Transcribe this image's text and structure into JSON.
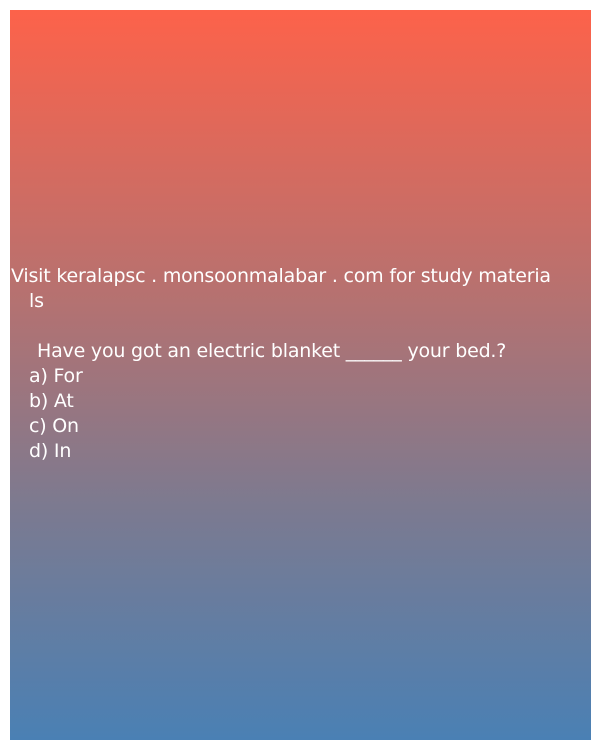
{
  "promo": {
    "line1": "Visit keralapsc . monsoonmalabar . com for study materia",
    "line2": "ls"
  },
  "question": {
    "text": "Have you got an electric blanket ______ your bed.?"
  },
  "options": [
    {
      "label": "a) For"
    },
    {
      "label": "b) At"
    },
    {
      "label": "c) On"
    },
    {
      "label": "d) In"
    }
  ],
  "colors": {
    "gradient_top": "#fd624a",
    "gradient_bottom": "#4a80b4",
    "text": "#ffffff"
  }
}
